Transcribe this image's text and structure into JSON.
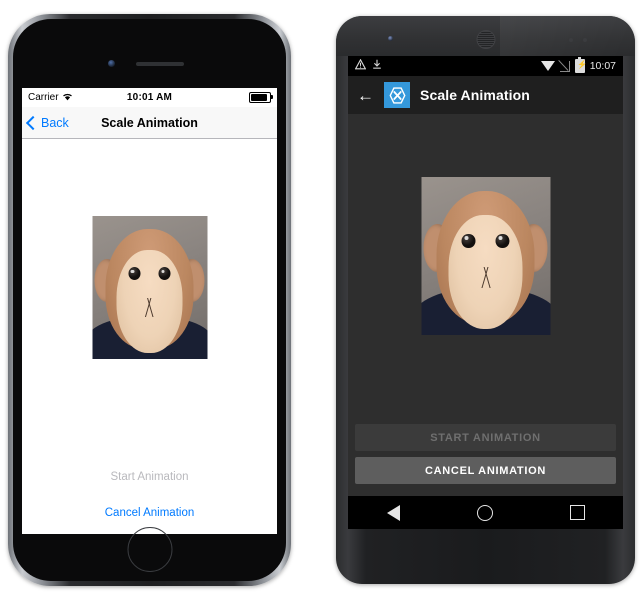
{
  "ios": {
    "status": {
      "carrier": "Carrier",
      "wifi_icon": "wifi-icon",
      "time": "10:01 AM",
      "battery_icon": "battery-full-icon"
    },
    "nav": {
      "back_label": "Back",
      "back_icon": "chevron-left-icon",
      "title": "Scale Animation"
    },
    "content": {
      "image_alt": "monkey-photo"
    },
    "buttons": {
      "start_label": "Start Animation",
      "cancel_label": "Cancel Animation"
    },
    "colors": {
      "accent": "#007aff",
      "disabled": "#b9b9bd",
      "nav_bg": "#f8f8f8",
      "screen_bg": "#ffffff"
    },
    "home_button": "home-button"
  },
  "android": {
    "status": {
      "warning_icon": "warning-triangle-icon",
      "download_icon": "download-icon",
      "wifi_icon": "wifi-icon",
      "signal_icon": "signal-off-icon",
      "battery_icon": "battery-charging-icon",
      "time": "10:07"
    },
    "appbar": {
      "back_icon": "arrow-left-icon",
      "logo": "xamarin-logo",
      "logo_glyph": "X",
      "title": "Scale Animation"
    },
    "content": {
      "image_alt": "monkey-photo"
    },
    "buttons": {
      "start_label": "START ANIMATION",
      "cancel_label": "CANCEL ANIMATION"
    },
    "navbar": {
      "back_icon": "nav-back-triangle-icon",
      "home_icon": "nav-home-circle-icon",
      "recents_icon": "nav-recents-square-icon"
    },
    "colors": {
      "brand": "#3498db",
      "appbar_bg": "#1f1f1f",
      "screen_bg": "#2e2e2e",
      "btn_disabled_bg": "#3b3b3b",
      "btn_enabled_bg": "#5e5e5e"
    }
  }
}
